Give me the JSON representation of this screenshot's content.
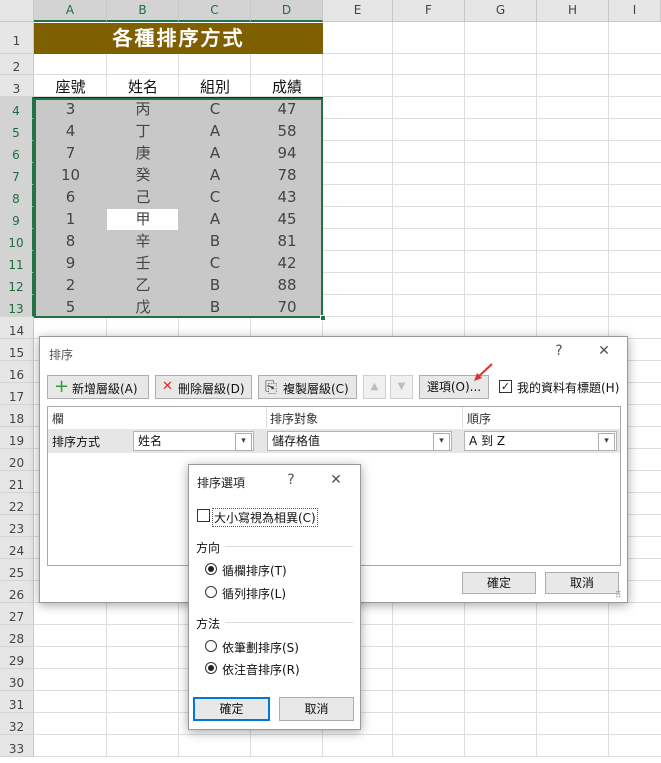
{
  "columns": [
    "A",
    "B",
    "C",
    "D",
    "E",
    "F",
    "G",
    "H",
    "I"
  ],
  "rows": [
    "1",
    "2",
    "3",
    "4",
    "5",
    "6",
    "7",
    "8",
    "9",
    "10",
    "11",
    "12",
    "13",
    "14",
    "15",
    "16",
    "17",
    "18",
    "19",
    "20",
    "21",
    "22",
    "23",
    "24",
    "25",
    "26",
    "27",
    "28",
    "29",
    "30",
    "31",
    "32",
    "33"
  ],
  "sheet": {
    "title": "各種排序方式",
    "headers": [
      "座號",
      "姓名",
      "組別",
      "成績"
    ],
    "table": [
      [
        "3",
        "丙",
        "C",
        "47"
      ],
      [
        "4",
        "丁",
        "A",
        "58"
      ],
      [
        "7",
        "庚",
        "A",
        "94"
      ],
      [
        "10",
        "癸",
        "A",
        "78"
      ],
      [
        "6",
        "己",
        "C",
        "43"
      ],
      [
        "1",
        "甲",
        "A",
        "45"
      ],
      [
        "8",
        "辛",
        "B",
        "81"
      ],
      [
        "9",
        "壬",
        "C",
        "42"
      ],
      [
        "2",
        "乙",
        "B",
        "88"
      ],
      [
        "5",
        "戊",
        "B",
        "70"
      ]
    ]
  },
  "sort_dialog": {
    "title": "排序",
    "help": "?",
    "close": "✕",
    "add_level": "新增層級(A)",
    "delete_level": "刪除層級(D)",
    "copy_level": "複製層級(C)",
    "up": "▲",
    "down": "▼",
    "options": "選項(O)...",
    "has_headers": "我的資料有標題(H)",
    "col_header_column": "欄",
    "col_header_sort_on": "排序對象",
    "col_header_order": "順序",
    "row_label": "排序方式",
    "column_value": "姓名",
    "sort_on_value": "儲存格值",
    "order_value": "A 到 Z",
    "ok": "確定",
    "cancel": "取消",
    "grip": "⠿"
  },
  "options_dialog": {
    "title": "排序選項",
    "help": "?",
    "close": "✕",
    "case_sensitive": "大小寫視為相異(C)",
    "direction_label": "方向",
    "dir_rows": "循欄排序(T)",
    "dir_cols": "循列排序(L)",
    "method_label": "方法",
    "method_stroke": "依筆劃排序(S)",
    "method_phonetic": "依注音排序(R)",
    "ok": "確定",
    "cancel": "取消"
  },
  "icons": {
    "plus": "+",
    "x_mark": "✕",
    "copy": "⎘",
    "chevron": "▾",
    "check": "✓"
  },
  "colors": {
    "title_bg": "#7f6000",
    "selection_border": "#217346",
    "selection_fill": "#c8c8c8",
    "primary_button_border": "#0078d7",
    "arrow": "#e0302c"
  }
}
